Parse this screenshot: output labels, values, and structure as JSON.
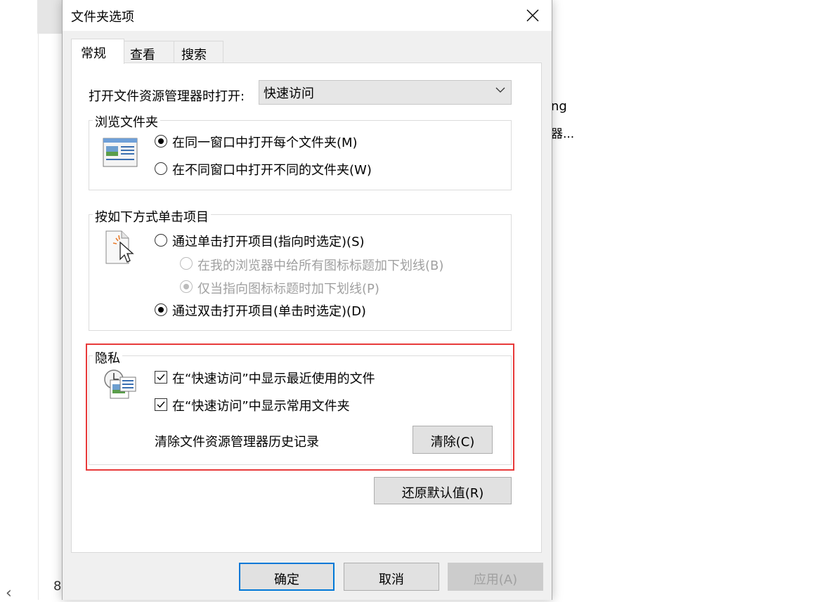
{
  "background": {
    "text_line1": "ng",
    "text_line2": "器...",
    "number": "8"
  },
  "dialog": {
    "title": "文件夹选项",
    "tabs": [
      "常规",
      "查看",
      "搜索"
    ],
    "open_label": "打开文件资源管理器时打开:",
    "open_value": "快速访问",
    "browse_group": {
      "title": "浏览文件夹",
      "option_same": "在同一窗口中打开每个文件夹(M)",
      "option_diff": "在不同窗口中打开不同的文件夹(W)"
    },
    "click_group": {
      "title": "按如下方式单击项目",
      "option_single": "通过单击打开项目(指向时选定)(S)",
      "sub_all": "在我的浏览器中给所有图标标题加下划线(B)",
      "sub_point": "仅当指向图标标题时加下划线(P)",
      "option_double": "通过双击打开项目(单击时选定)(D)"
    },
    "privacy_group": {
      "title": "隐私",
      "check_recent": "在“快速访问”中显示最近使用的文件",
      "check_frequent": "在“快速访问”中显示常用文件夹",
      "clear_label": "清除文件资源管理器历史记录",
      "clear_button": "清除(C)"
    },
    "restore_button": "还原默认值(R)",
    "ok_button": "确定",
    "cancel_button": "取消",
    "apply_button": "应用(A)"
  }
}
